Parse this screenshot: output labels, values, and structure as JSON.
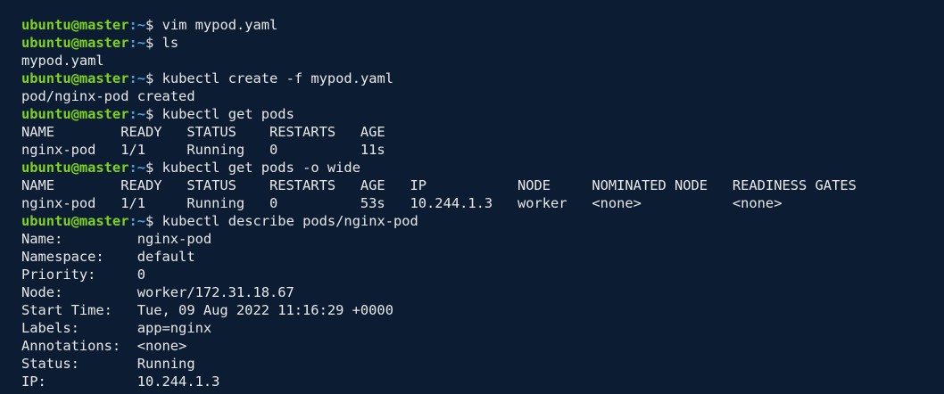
{
  "terminal": {
    "prompt": {
      "user_host": "ubuntu@master",
      "colon": ":",
      "path": "~",
      "symbol": "$ "
    },
    "lines": [
      {
        "type": "cmd",
        "text": "vim mypod.yaml"
      },
      {
        "type": "cmd",
        "text": "ls"
      },
      {
        "type": "out",
        "text": "mypod.yaml"
      },
      {
        "type": "cmd",
        "text": "kubectl create -f mypod.yaml"
      },
      {
        "type": "out",
        "text": "pod/nginx-pod created"
      },
      {
        "type": "cmd",
        "text": "kubectl get pods"
      },
      {
        "type": "out",
        "text": "NAME        READY   STATUS    RESTARTS   AGE"
      },
      {
        "type": "out",
        "text": "nginx-pod   1/1     Running   0          11s"
      },
      {
        "type": "cmd",
        "text": "kubectl get pods -o wide"
      },
      {
        "type": "out",
        "text": "NAME        READY   STATUS    RESTARTS   AGE   IP           NODE     NOMINATED NODE   READINESS GATES"
      },
      {
        "type": "out",
        "text": "nginx-pod   1/1     Running   0          53s   10.244.1.3   worker   <none>           <none>"
      },
      {
        "type": "cmd",
        "text": "kubectl describe pods/nginx-pod"
      },
      {
        "type": "out",
        "text": "Name:         nginx-pod"
      },
      {
        "type": "out",
        "text": "Namespace:    default"
      },
      {
        "type": "out",
        "text": "Priority:     0"
      },
      {
        "type": "out",
        "text": "Node:         worker/172.31.18.67"
      },
      {
        "type": "out",
        "text": "Start Time:   Tue, 09 Aug 2022 11:16:29 +0000"
      },
      {
        "type": "out",
        "text": "Labels:       app=nginx"
      },
      {
        "type": "out",
        "text": "Annotations:  <none>"
      },
      {
        "type": "out",
        "text": "Status:       Running"
      },
      {
        "type": "out",
        "text": "IP:           10.244.1.3"
      }
    ]
  }
}
